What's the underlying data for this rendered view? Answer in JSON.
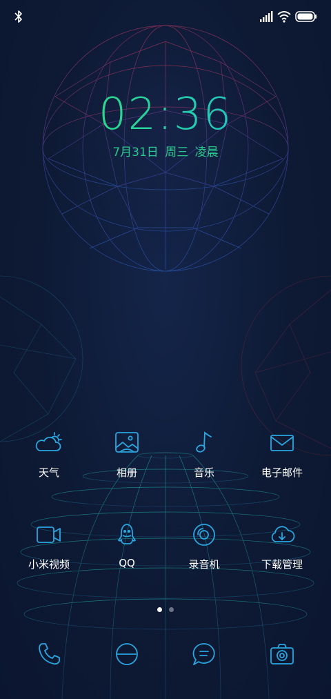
{
  "lockscreen": {
    "time": "02:36",
    "date": {
      "month_day": "7月31日",
      "weekday": "周三",
      "period": "凌晨"
    }
  },
  "status_bar": {
    "icons": [
      "bluetooth-icon",
      "signal-icon",
      "wifi-icon",
      "battery-icon"
    ],
    "battery_level": 1.0
  },
  "apps_row1": [
    {
      "label": "天气",
      "icon": "weather-icon"
    },
    {
      "label": "相册",
      "icon": "gallery-icon"
    },
    {
      "label": "音乐",
      "icon": "music-icon"
    },
    {
      "label": "电子邮件",
      "icon": "email-icon"
    }
  ],
  "apps_row2": [
    {
      "label": "小米视频",
      "icon": "video-icon"
    },
    {
      "label": "QQ",
      "icon": "qq-icon"
    },
    {
      "label": "录音机",
      "icon": "recorder-icon"
    },
    {
      "label": "下载管理",
      "icon": "download-manager-icon"
    }
  ],
  "page_indicator": {
    "pages": 2,
    "current": 1
  },
  "dock": [
    {
      "icon": "phone-icon"
    },
    {
      "icon": "browser-icon"
    },
    {
      "icon": "messages-icon"
    },
    {
      "icon": "camera-icon"
    }
  ],
  "colors": {
    "background": "#0f1a33",
    "icon_accent": "#2aa6e0",
    "clock_start": "#31d96a",
    "clock_end": "#19b6ea",
    "date_text": "#29c98e"
  }
}
